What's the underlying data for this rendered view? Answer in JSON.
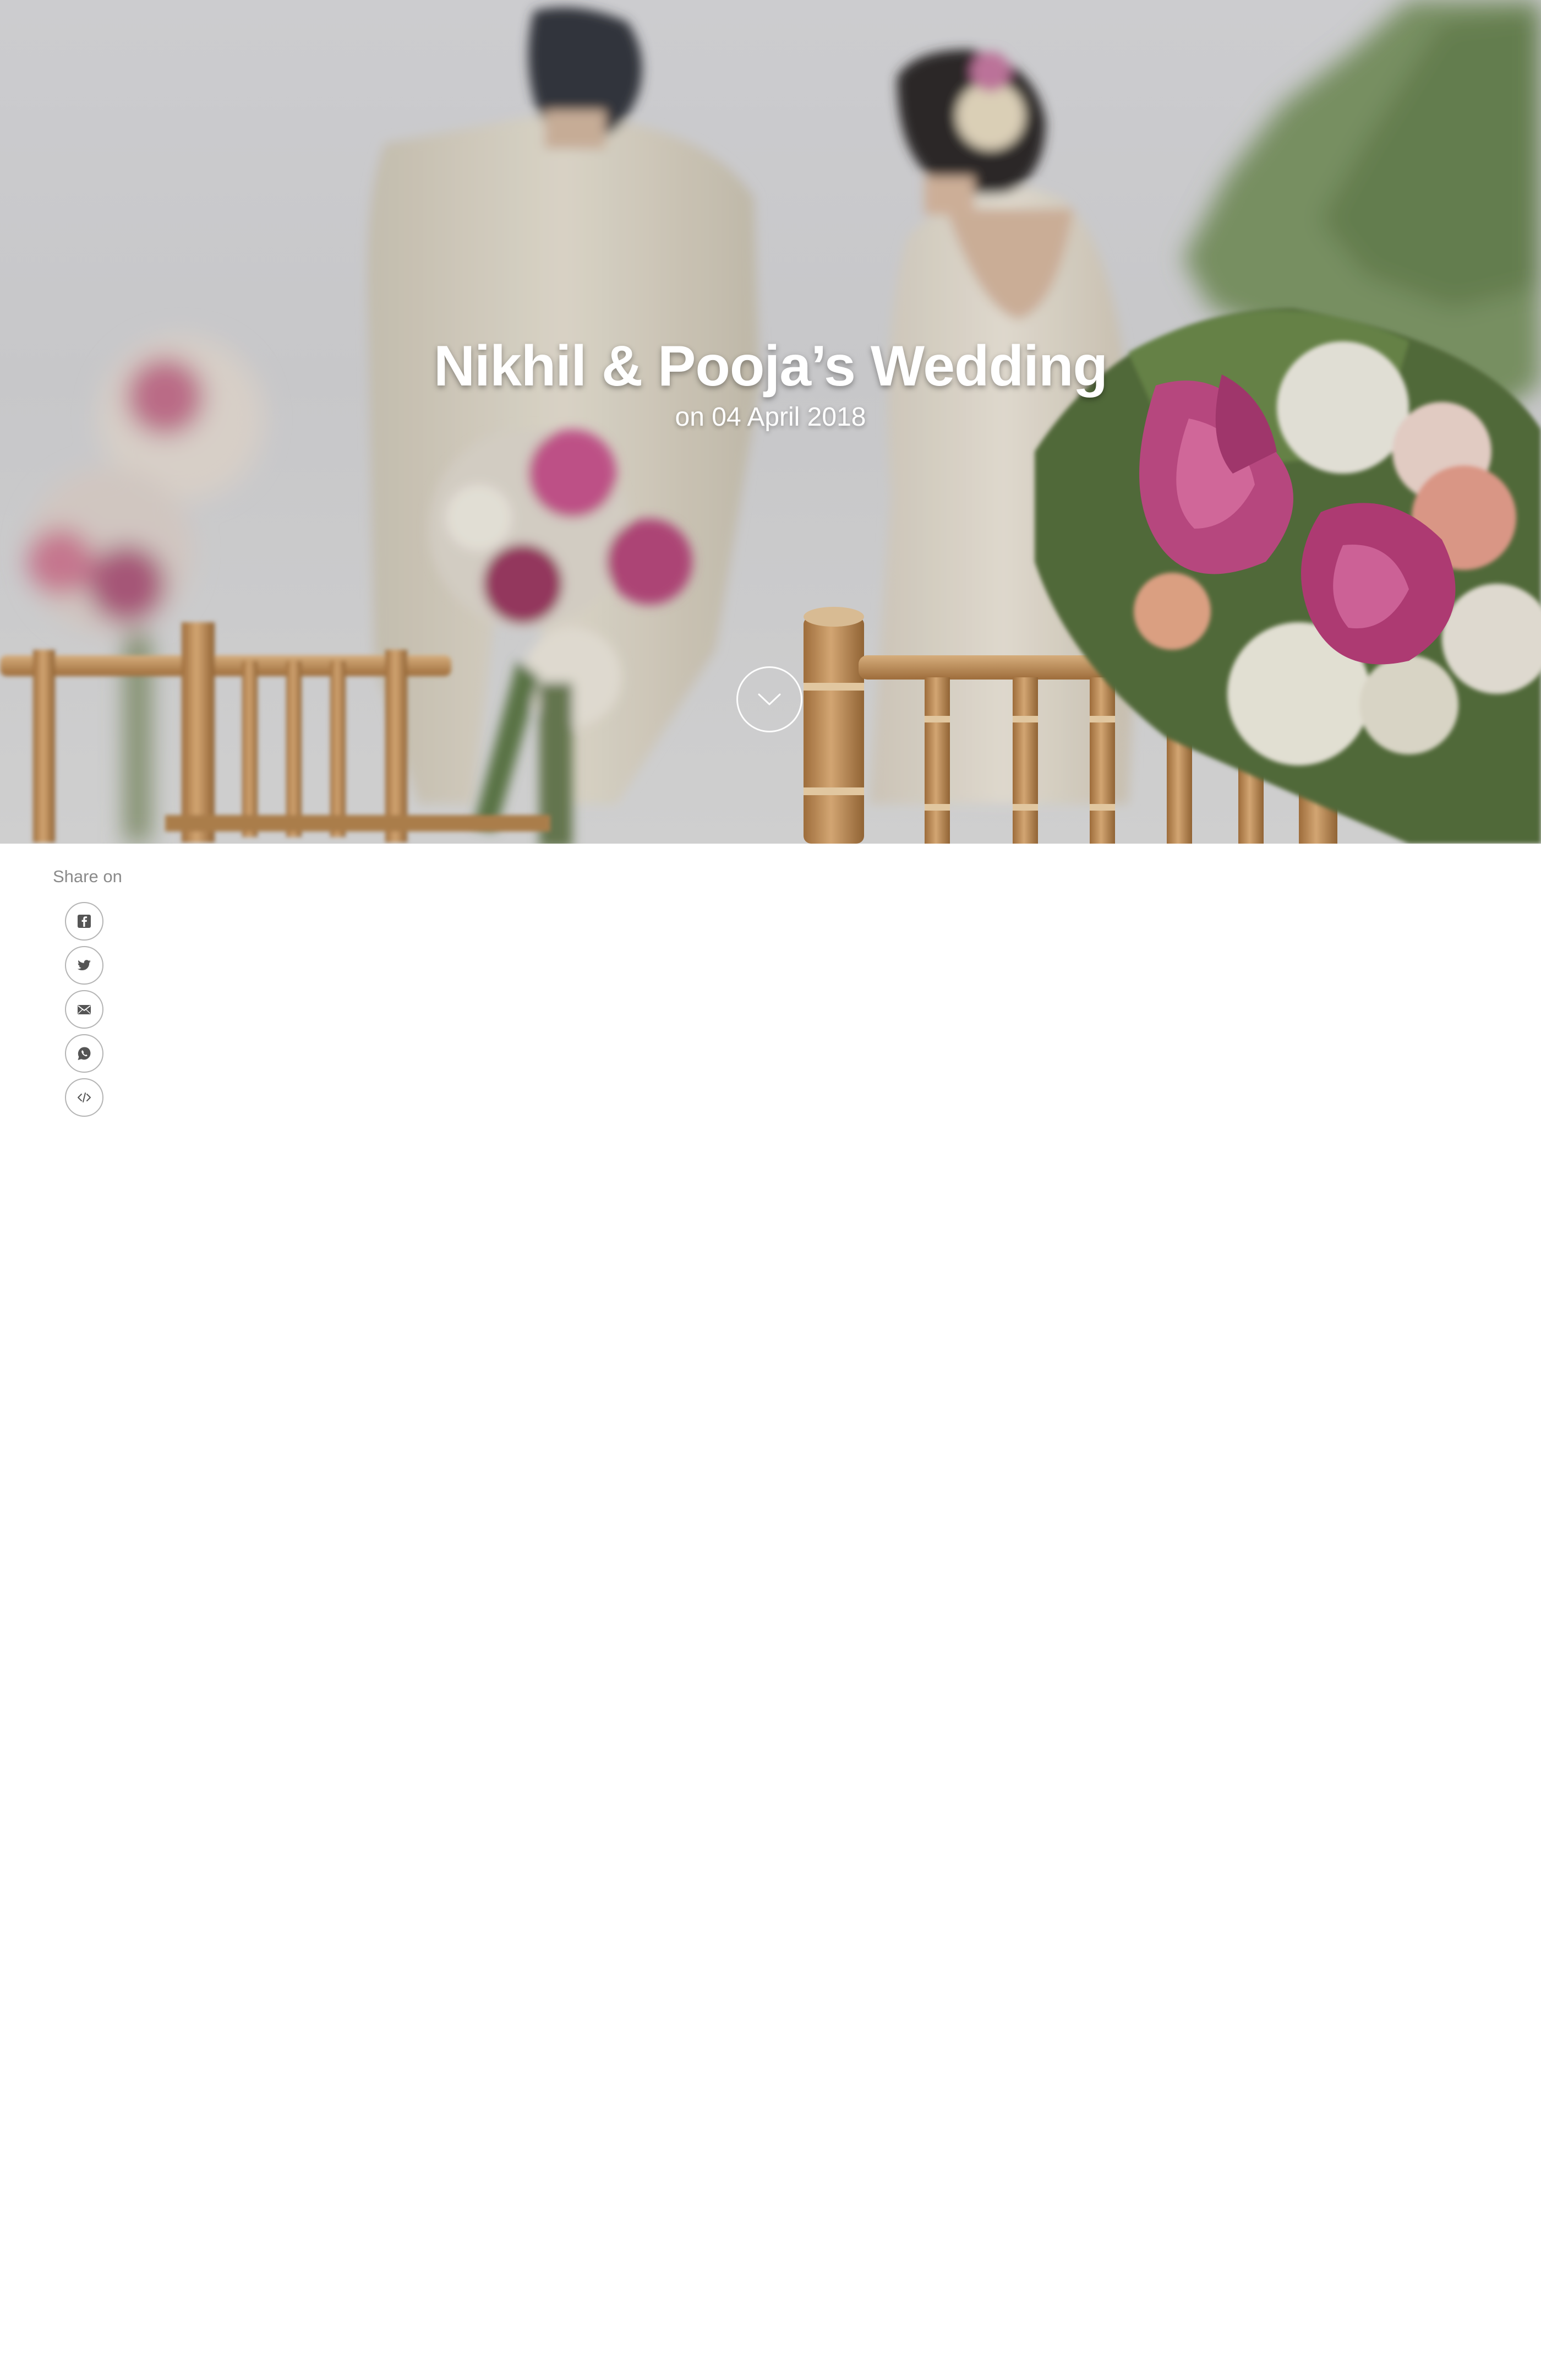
{
  "hero": {
    "title": "Nikhil & Pooja’s Wedding",
    "date": "on 04 April 2018",
    "scroll_icon": "chevron-down-icon"
  },
  "share": {
    "label": "Share on",
    "buttons": [
      {
        "name": "facebook",
        "icon": "facebook-icon"
      },
      {
        "name": "twitter",
        "icon": "twitter-icon"
      },
      {
        "name": "email",
        "icon": "mail-icon"
      },
      {
        "name": "whatsapp",
        "icon": "whatsapp-icon"
      },
      {
        "name": "embed",
        "icon": "code-icon"
      }
    ]
  },
  "colors": {
    "title_text": "#ffffff",
    "share_label": "#8a8a8a",
    "icon_stroke": "#555555",
    "flower_pink": "#c24c86",
    "chair_gold": "#c9955e",
    "foliage_green": "#6f8a55"
  }
}
